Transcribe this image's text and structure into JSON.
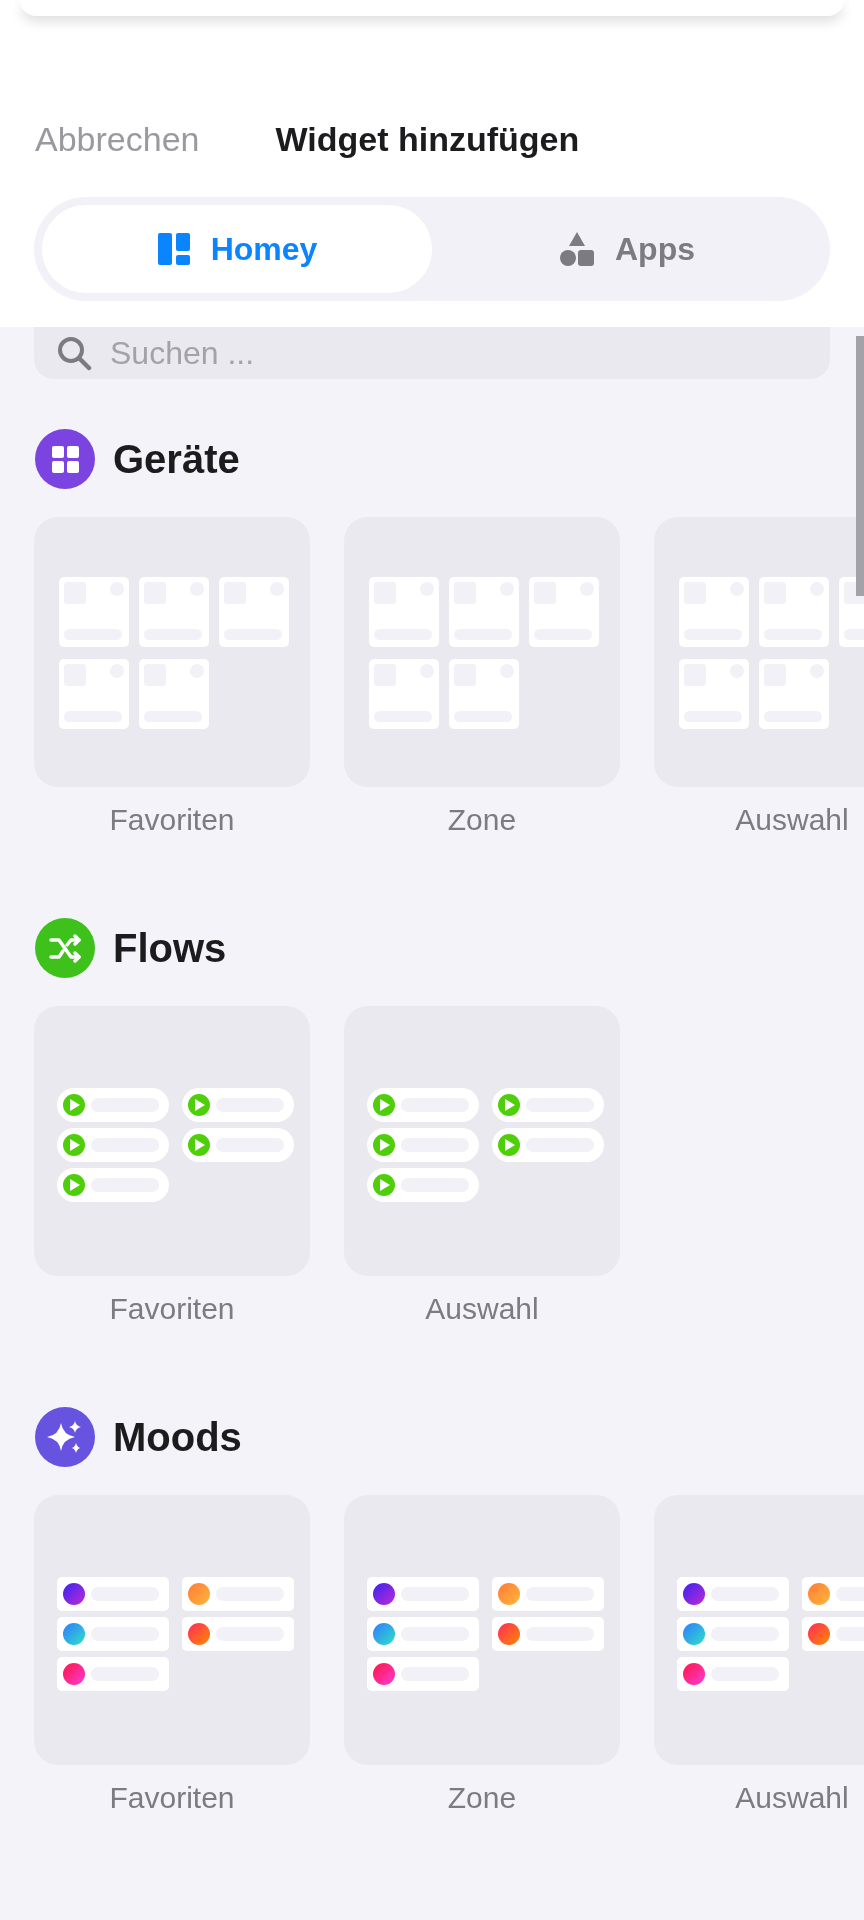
{
  "header": {
    "cancel": "Abbrechen",
    "title": "Widget hinzufügen"
  },
  "tabs": [
    {
      "label": "Homey",
      "selected": true,
      "kind": "homey"
    },
    {
      "label": "Apps",
      "selected": false,
      "kind": "apps"
    }
  ],
  "search": {
    "placeholder": "Suchen ..."
  },
  "sections": [
    {
      "title": "Geräte",
      "kind": "devices",
      "color": "#7b44e0",
      "widgets": [
        {
          "label": "Favoriten"
        },
        {
          "label": "Zone"
        },
        {
          "label": "Auswahl"
        }
      ]
    },
    {
      "title": "Flows",
      "kind": "flows",
      "color": "#3ec21b",
      "widgets": [
        {
          "label": "Favoriten"
        },
        {
          "label": "Auswahl"
        }
      ]
    },
    {
      "title": "Moods",
      "kind": "moods",
      "color": "#6653e0",
      "widgets": [
        {
          "label": "Favoriten"
        },
        {
          "label": "Zone"
        },
        {
          "label": "Auswahl"
        }
      ]
    }
  ]
}
